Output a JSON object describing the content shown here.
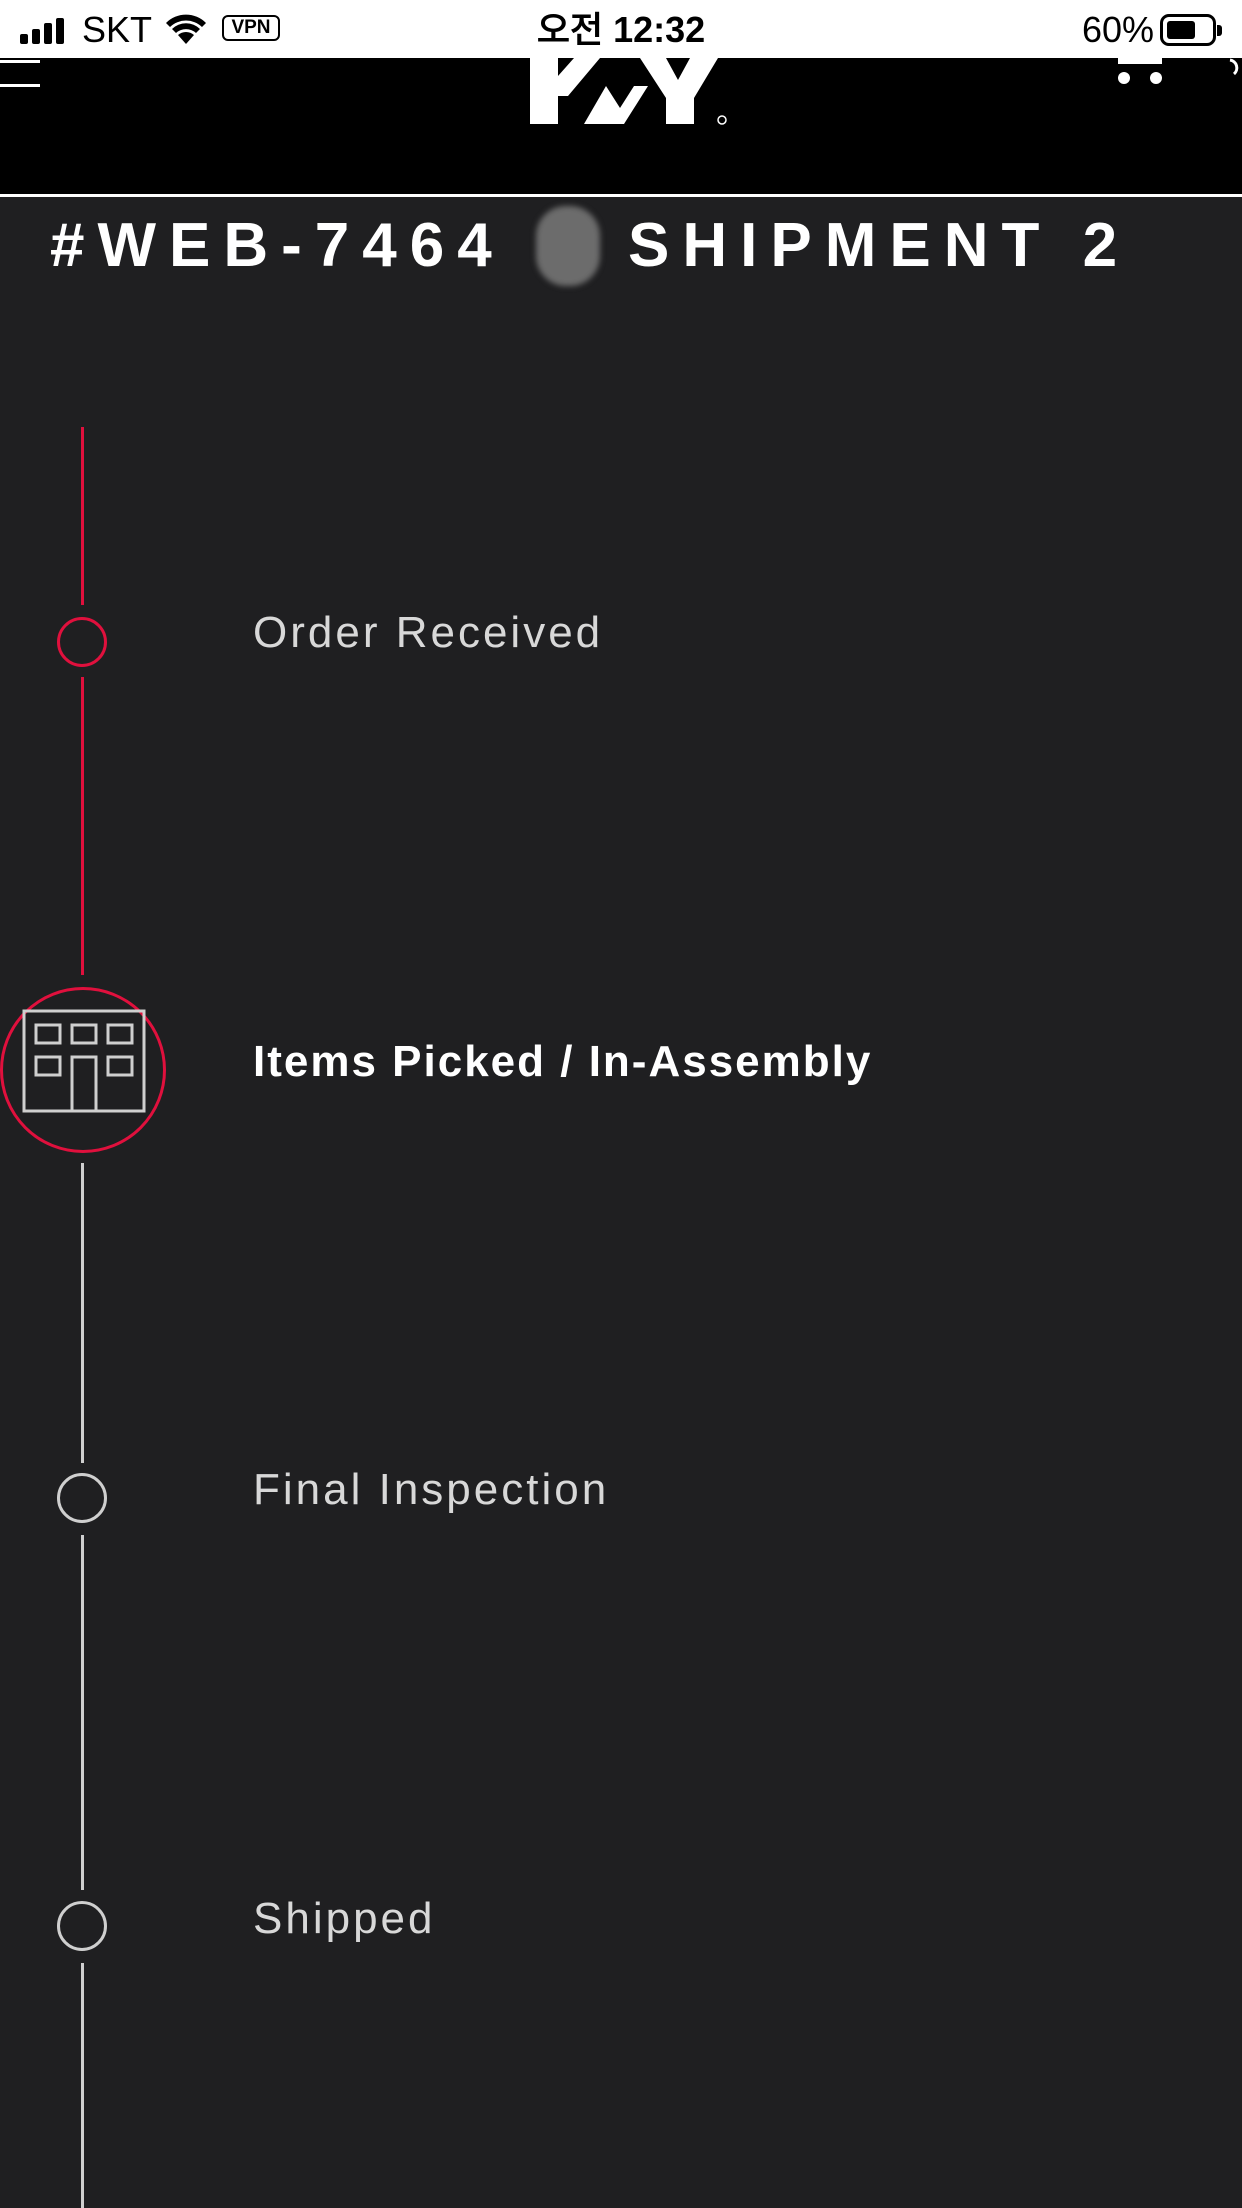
{
  "status_bar": {
    "carrier": "SKT",
    "vpn": "VPN",
    "time": "오전 12:32",
    "battery_percent": "60%",
    "battery_level": 0.6,
    "icons": [
      "signal-icon",
      "wifi-icon",
      "battery-icon"
    ]
  },
  "header": {
    "icons": [
      "menu-icon",
      "logo",
      "cart-icon"
    ],
    "background": "#000000"
  },
  "order": {
    "number": "#WEB-7464",
    "shipment": "SHIPMENT 2"
  },
  "timeline": {
    "steps": [
      {
        "label": "Order Received",
        "state": "completed"
      },
      {
        "label": "Items Picked / In-Assembly",
        "state": "current",
        "icon": "warehouse-icon"
      },
      {
        "label": "Final Inspection",
        "state": "pending"
      },
      {
        "label": "Shipped",
        "state": "pending"
      }
    ],
    "accent_color": "#e0103d",
    "inactive_color": "#cfcfcf"
  },
  "colors": {
    "page_background": "#1f1f21",
    "text": "#ffffff"
  }
}
